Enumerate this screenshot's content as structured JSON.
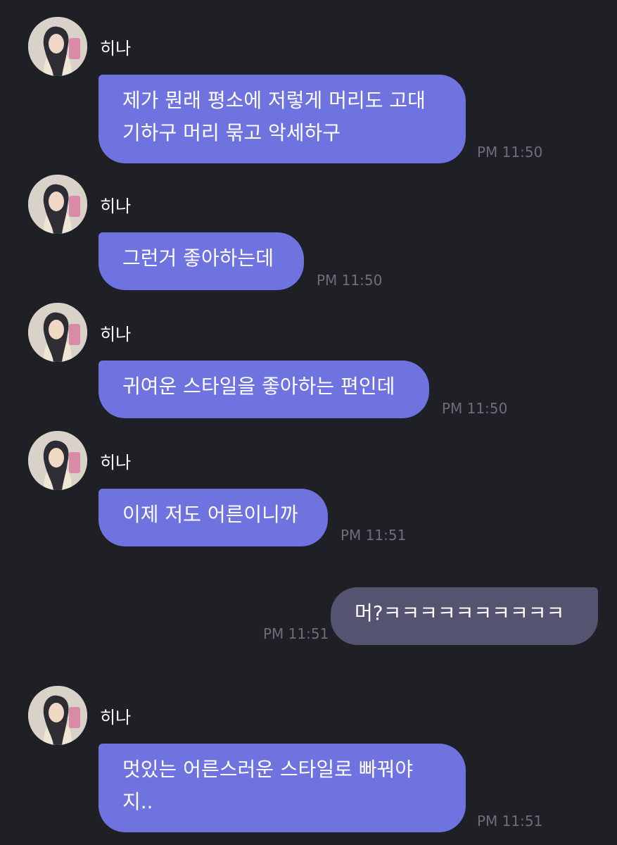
{
  "messages": [
    {
      "sender": "히나",
      "text": "제가 뭔래 평소에 저렇게 머리도 고대\n기하구 머리 묶고 악세하구",
      "time": "PM 11:50",
      "direction": "in"
    },
    {
      "sender": "히나",
      "text": "그런거 좋아하는데",
      "time": "PM 11:50",
      "direction": "in"
    },
    {
      "sender": "히나",
      "text": "귀여운 스타일을 좋아하는 편인데",
      "time": "PM 11:50",
      "direction": "in"
    },
    {
      "sender": "히나",
      "text": "이제 저도 어른이니까",
      "time": "PM 11:51",
      "direction": "in"
    },
    {
      "sender": "",
      "text": "머?ㅋㅋㅋㅋㅋㅋㅋㅋㅋㅋ",
      "time": "PM 11:51",
      "direction": "out"
    },
    {
      "sender": "히나",
      "text": "멋있는 어른스러운 스타일로 빠꿔야\n지..",
      "time": "PM 11:51",
      "direction": "in"
    }
  ],
  "colors": {
    "background": "#1f1f26",
    "incoming_bubble": "#6f73df",
    "outgoing_bubble": "#545470",
    "time_text": "#6e6e7a"
  },
  "icons": {
    "avatar": "profile-photo"
  }
}
